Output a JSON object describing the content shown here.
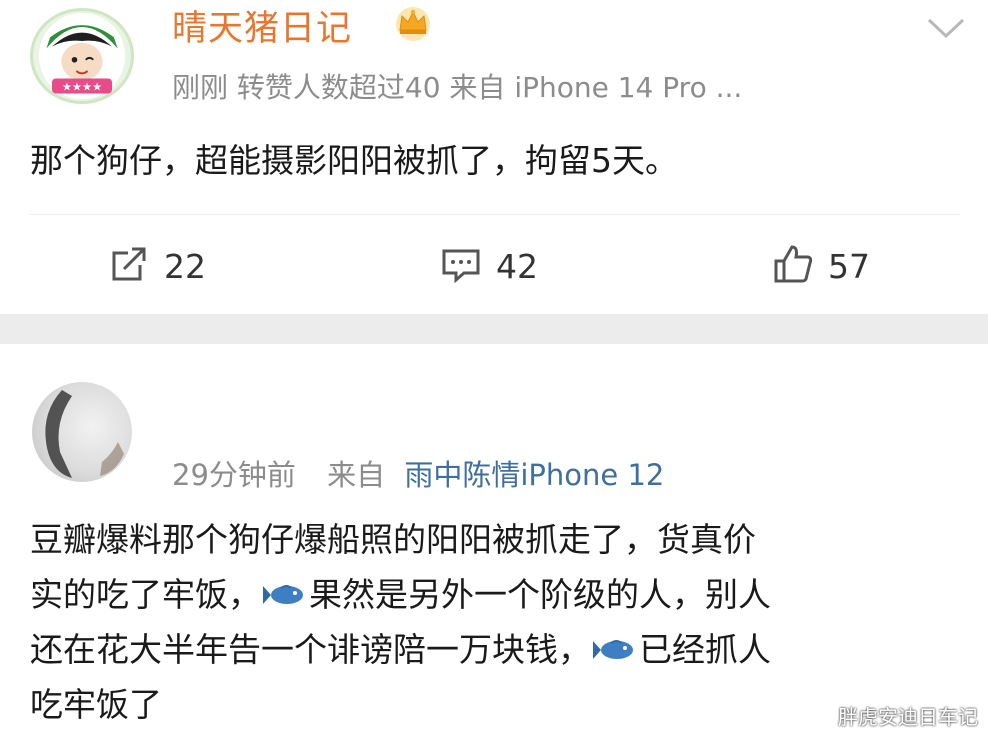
{
  "post1": {
    "username": "晴天猪日记",
    "meta": "刚刚 转赞人数超过40   来自 iPhone 14 Pro ...",
    "text": "那个狗仔，超能摄影阳阳被抓了，拘留5天。",
    "actions": {
      "share_count": "22",
      "comment_count": "42",
      "like_count": "57"
    }
  },
  "post2": {
    "time": "29分钟前",
    "from_label": "来自",
    "source": "雨中陈情iPhone 12",
    "text_line1": "豆瓣爆料那个狗仔爆船照的阳阳被抓走了，货真价",
    "text_line2a": "实的吃了牢饭，",
    "text_line2b": "果然是另外一个阶级的人，别人",
    "text_line3a": "还在花大半年告一个诽谤陪一万块钱，",
    "text_line3b": "已经抓人",
    "text_line4": "吃牢饭了"
  },
  "watermark": "胖虎安迪日车记",
  "colors": {
    "username": "#e8762c",
    "meta": "#8c8c8c",
    "source_link": "#3f6f9e",
    "separator": "#ececec"
  },
  "icons": [
    "avatar",
    "crown-icon",
    "chevron-down-icon",
    "share-icon",
    "comment-icon",
    "like-icon",
    "fish-emoji-icon"
  ]
}
